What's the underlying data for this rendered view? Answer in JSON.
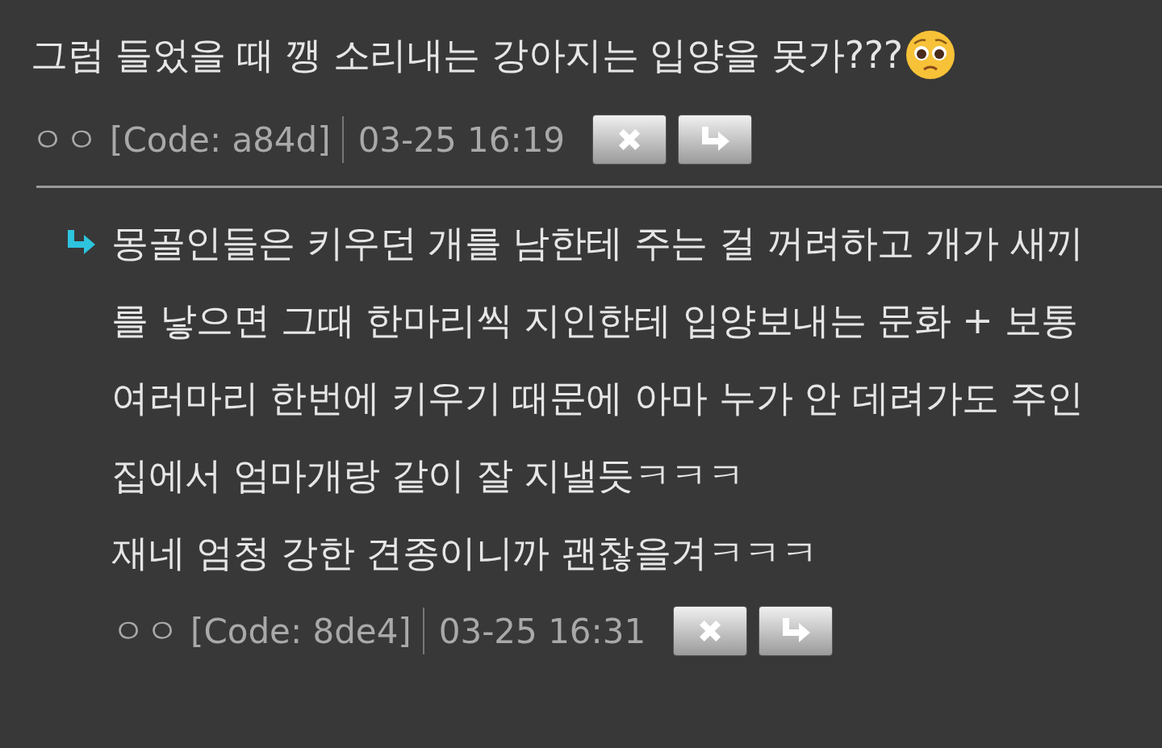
{
  "comments": [
    {
      "lines": [
        "그럼 들었을 때 깽 소리내는 강아지는 입양을 못가???"
      ],
      "emoji": true,
      "reply": false,
      "author": "ㅇㅇ",
      "code": "[Code: a84d]",
      "time": "03-25 16:19"
    },
    {
      "lines": [
        "몽골인들은 키우던 개를 남한테 주는 걸 꺼려하고 개가 새끼",
        "를 낳으면 그때 한마리씩 지인한테 입양보내는 문화 + 보통",
        "여러마리 한번에 키우기 때문에 아마 누가 안 데려가도 주인",
        "집에서 엄마개랑 같이 잘 지낼듯ㅋㅋㅋ",
        "재네 엄청 강한 견종이니까 괜찮을겨ㅋㅋㅋ"
      ],
      "emoji": false,
      "reply": true,
      "author": "ㅇㅇ",
      "code": "[Code: 8de4]",
      "time": "03-25 16:31"
    }
  ]
}
